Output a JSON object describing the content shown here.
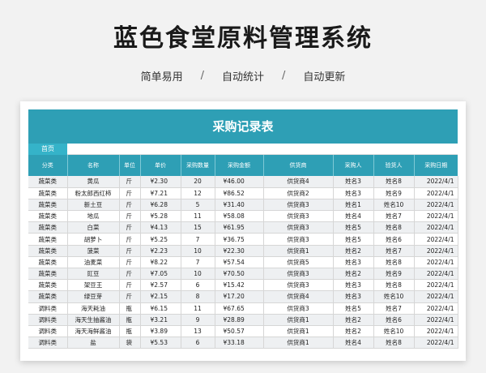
{
  "page": {
    "title": "蓝色食堂原料管理系统",
    "taglines": [
      "简单易用",
      "自动统计",
      "自动更新"
    ],
    "separator": "/"
  },
  "sheet": {
    "banner_title": "采购记录表",
    "home_tab": "首页",
    "columns": [
      "分类",
      "名称",
      "单位",
      "单价",
      "采购数量",
      "采购金额",
      "供货商",
      "采购人",
      "验货人",
      "采购日期"
    ],
    "rows": [
      [
        "蔬菜类",
        "黄瓜",
        "斤",
        "¥2.30",
        "20",
        "¥46.00",
        "供货商4",
        "姓名3",
        "姓名8",
        "2022/4/1"
      ],
      [
        "蔬菜类",
        "粉太郎西红柿",
        "斤",
        "¥7.21",
        "12",
        "¥86.52",
        "供货商2",
        "姓名3",
        "姓名9",
        "2022/4/1"
      ],
      [
        "蔬菜类",
        "新土豆",
        "斤",
        "¥6.28",
        "5",
        "¥31.40",
        "供货商3",
        "姓名1",
        "姓名10",
        "2022/4/1"
      ],
      [
        "蔬菜类",
        "地瓜",
        "斤",
        "¥5.28",
        "11",
        "¥58.08",
        "供货商3",
        "姓名4",
        "姓名7",
        "2022/4/1"
      ],
      [
        "蔬菜类",
        "白菜",
        "斤",
        "¥4.13",
        "15",
        "¥61.95",
        "供货商3",
        "姓名5",
        "姓名8",
        "2022/4/1"
      ],
      [
        "蔬菜类",
        "胡萝卜",
        "斤",
        "¥5.25",
        "7",
        "¥36.75",
        "供货商3",
        "姓名5",
        "姓名6",
        "2022/4/1"
      ],
      [
        "蔬菜类",
        "菠菜",
        "斤",
        "¥2.23",
        "10",
        "¥22.30",
        "供货商1",
        "姓名2",
        "姓名7",
        "2022/4/1"
      ],
      [
        "蔬菜类",
        "油麦菜",
        "斤",
        "¥8.22",
        "7",
        "¥57.54",
        "供货商5",
        "姓名3",
        "姓名8",
        "2022/4/1"
      ],
      [
        "蔬菜类",
        "豇豆",
        "斤",
        "¥7.05",
        "10",
        "¥70.50",
        "供货商3",
        "姓名2",
        "姓名9",
        "2022/4/1"
      ],
      [
        "蔬菜类",
        "架豆王",
        "斤",
        "¥2.57",
        "6",
        "¥15.42",
        "供货商3",
        "姓名3",
        "姓名8",
        "2022/4/1"
      ],
      [
        "蔬菜类",
        "绿豆芽",
        "斤",
        "¥2.15",
        "8",
        "¥17.20",
        "供货商4",
        "姓名3",
        "姓名10",
        "2022/4/1"
      ],
      [
        "调料类",
        "海天耗油",
        "瓶",
        "¥6.15",
        "11",
        "¥67.65",
        "供货商3",
        "姓名5",
        "姓名7",
        "2022/4/1"
      ],
      [
        "调料类",
        "海天生抽酱油",
        "瓶",
        "¥3.21",
        "9",
        "¥28.89",
        "供货商1",
        "姓名2",
        "姓名6",
        "2022/4/1"
      ],
      [
        "调料类",
        "海天海鲜酱油",
        "瓶",
        "¥3.89",
        "13",
        "¥50.57",
        "供货商1",
        "姓名2",
        "姓名10",
        "2022/4/1"
      ],
      [
        "调料类",
        "盐",
        "袋",
        "¥5.53",
        "6",
        "¥33.18",
        "供货商1",
        "姓名4",
        "姓名8",
        "2022/4/1"
      ]
    ]
  }
}
